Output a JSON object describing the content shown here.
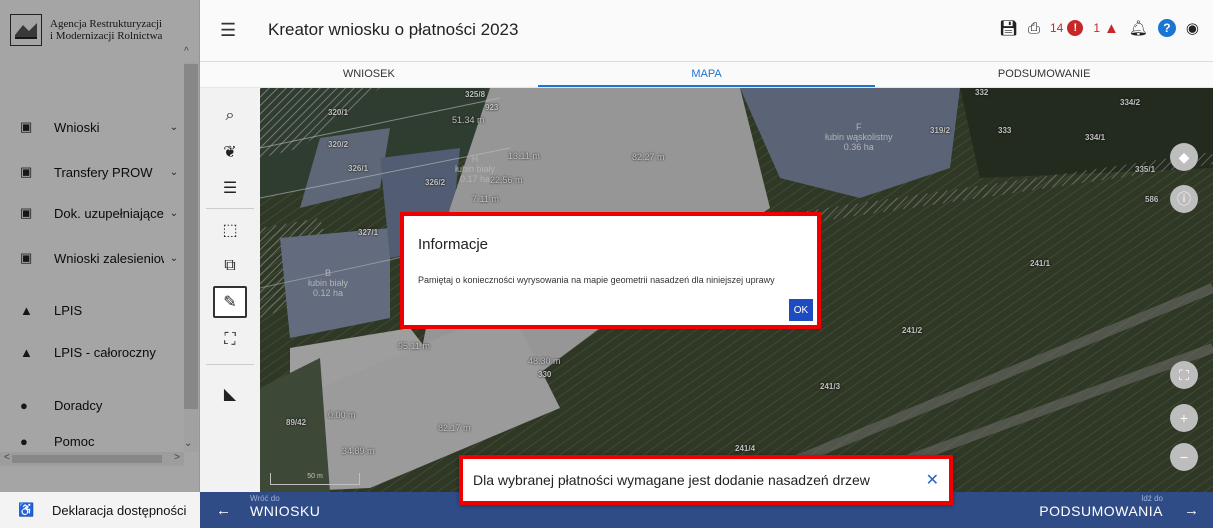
{
  "logo": {
    "line1": "Agencja Restrukturyzacji",
    "line2": "i Modernizacji Rolnictwa"
  },
  "sidebar": {
    "items": [
      {
        "label": "Wnioski",
        "icon": "clipboard-icon",
        "chevron": "⌄"
      },
      {
        "label": "Transfery PROW",
        "icon": "clipboard-icon",
        "chevron": "⌄"
      },
      {
        "label": "Dok. uzupełniające",
        "icon": "clipboard-icon",
        "chevron": "⌄"
      },
      {
        "label": "Wnioski zalesieniowe",
        "icon": "clipboard-icon",
        "chevron": "⌄"
      },
      {
        "label": "LPIS",
        "icon": "terrain-icon",
        "chevron": ""
      },
      {
        "label": "LPIS - całoroczny",
        "icon": "terrain-icon",
        "chevron": ""
      },
      {
        "label": "Doradcy",
        "icon": "person-icon",
        "chevron": ""
      },
      {
        "label": "Pomoc",
        "icon": "help-icon",
        "chevron": ""
      }
    ],
    "footer_item": {
      "label": "Deklaracja dostępności",
      "icon": "accessibility-icon"
    }
  },
  "header": {
    "title": "Kreator wniosku o płatności 2023",
    "error_count": "14",
    "warning_count": "1"
  },
  "tabs": [
    {
      "label": "WNIOSEK",
      "active": false
    },
    {
      "label": "MAPA",
      "active": true
    },
    {
      "label": "PODSUMOWANIE",
      "active": false
    }
  ],
  "map": {
    "parcels": [
      "320/1",
      "320/2",
      "326/1",
      "326/2",
      "327/1",
      "325/8",
      "923",
      "332",
      "334/2",
      "333",
      "334/1",
      "335/1",
      "586",
      "319/2",
      "241/1",
      "241/2",
      "241/3",
      "241/4",
      "330",
      "89/42"
    ],
    "fields": [
      {
        "letter": "H",
        "crop": "łubin biały",
        "area": "0.17 ha"
      },
      {
        "letter": "B",
        "crop": "łubin biały",
        "area": "0.12 ha"
      },
      {
        "letter": "F",
        "crop": "łubin wąskolistny",
        "area": "0.36 ha"
      }
    ],
    "measurements": [
      "51.34 m",
      "13.11 m",
      "82.27 m",
      "22.56 m",
      "7.11 m",
      "95.11 m",
      "48.30 m",
      "0.00 m",
      "82.17 m",
      "34.89 m"
    ],
    "scale_label": "50 m"
  },
  "dialog": {
    "title": "Informacje",
    "message": "Pamiętaj o konieczności wyrysowania na mapie geometrii nasadzeń dla niniejszej uprawy",
    "ok_label": "OK"
  },
  "toast": {
    "message": "Dla wybranej płatności wymagane jest dodanie nasadzeń drzew",
    "close": "✕"
  },
  "footer": {
    "back_small": "Wróć do",
    "back_big": "WNIOSKU",
    "next_small": "Idź do",
    "next_big": "PODSUMOWANIA"
  }
}
